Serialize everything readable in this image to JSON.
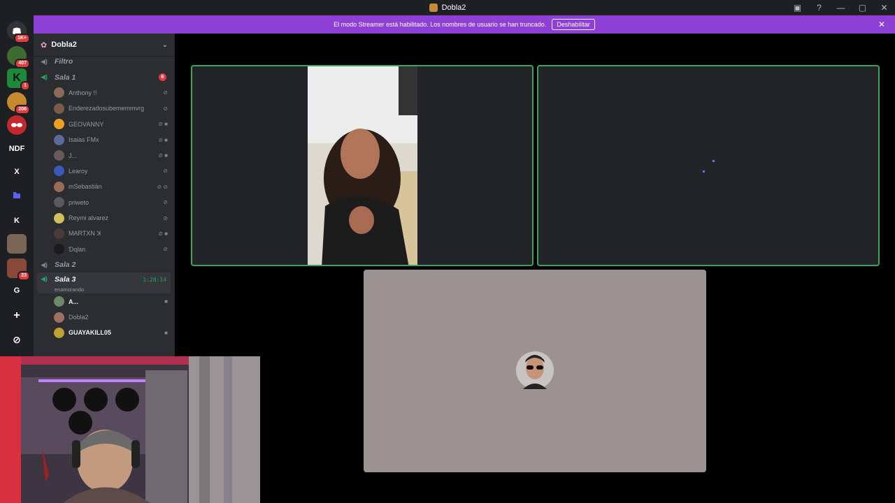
{
  "window": {
    "title": "Dobla2",
    "controls": [
      "—",
      "▢",
      "✕"
    ]
  },
  "banner": {
    "message": "El modo Streamer está habilitado. Los nombres de usuario se han truncado.",
    "button": "Deshabilitar",
    "close": "✕"
  },
  "guilds": [
    {
      "label": "",
      "badge": "1K+",
      "color": "#313338"
    },
    {
      "label": "",
      "badge": "407",
      "color": "#3d6b2f"
    },
    {
      "label": "",
      "badge": "1",
      "color": "#1d8a3a"
    },
    {
      "label": "",
      "badge": "206",
      "color": "#c48a2d"
    },
    {
      "label": "",
      "badge": "",
      "color": "#c3282e"
    },
    {
      "label": "NDF",
      "badge": "",
      "color": "#1e1f22"
    },
    {
      "label": "X",
      "badge": "",
      "color": "#1e1f22"
    },
    {
      "label": "",
      "badge": "",
      "color": "#1e1f22"
    },
    {
      "label": "K",
      "badge": "",
      "color": "#1e1f22"
    },
    {
      "label": "",
      "badge": "",
      "color": "#7a6455"
    },
    {
      "label": "",
      "badge": "23",
      "color": "#8a4a3a"
    },
    {
      "label": "G",
      "badge": "",
      "color": "#1e1f22"
    },
    {
      "label": "+",
      "badge": "",
      "color": "#1e1f22"
    },
    {
      "label": "⊘",
      "badge": "",
      "color": "#1e1f22"
    }
  ],
  "server": {
    "name": "Dobla2"
  },
  "channels": {
    "filtro": {
      "name": "Filtro"
    },
    "sala1": {
      "name": "Sala 1",
      "count": "6"
    },
    "sala2": {
      "name": "Sala 2"
    },
    "sala3": {
      "name": "Sala 3",
      "timer": "1:28:14",
      "status": "enamorando"
    }
  },
  "sala1_users": [
    {
      "name": "Anthony !!",
      "avatar": "#8a6a5a",
      "icons": "⊘"
    },
    {
      "name": "Enderezadosubememmvrg",
      "avatar": "#7a5a4a",
      "icons": "⊘"
    },
    {
      "name": "GEOVANNY",
      "avatar": "#f0a020",
      "icons": "⊘ ■"
    },
    {
      "name": "Isaias FMx",
      "avatar": "#5a6a9a",
      "icons": "⊘ ■"
    },
    {
      "name": "J...",
      "avatar": "#6a5a5a",
      "icons": "⊘ ■"
    },
    {
      "name": "Learoy",
      "avatar": "#3a5aba",
      "icons": "⊘"
    },
    {
      "name": "mSebastián",
      "avatar": "#9a6a5a",
      "icons": "⊘ ⊘"
    },
    {
      "name": "priweto",
      "avatar": "#5a5a5a",
      "icons": "⊘"
    },
    {
      "name": "Reymi alvarez",
      "avatar": "#d0c060",
      "icons": "⊘"
    },
    {
      "name": "MARTXN ꓘ",
      "avatar": "#4a3a3a",
      "icons": "⊘ ■"
    },
    {
      "name": "Ɗɋlan",
      "avatar": "#1a1a1a",
      "icons": "⊘"
    }
  ],
  "sala3_users": [
    {
      "name": "A...",
      "avatar": "#6a8a6a",
      "icons": "■"
    },
    {
      "name": "Dobla2",
      "avatar": "#a07060",
      "icons": ""
    },
    {
      "name": "GUAYAKILL05",
      "avatar": "#c0a030",
      "icons": "■"
    }
  ]
}
